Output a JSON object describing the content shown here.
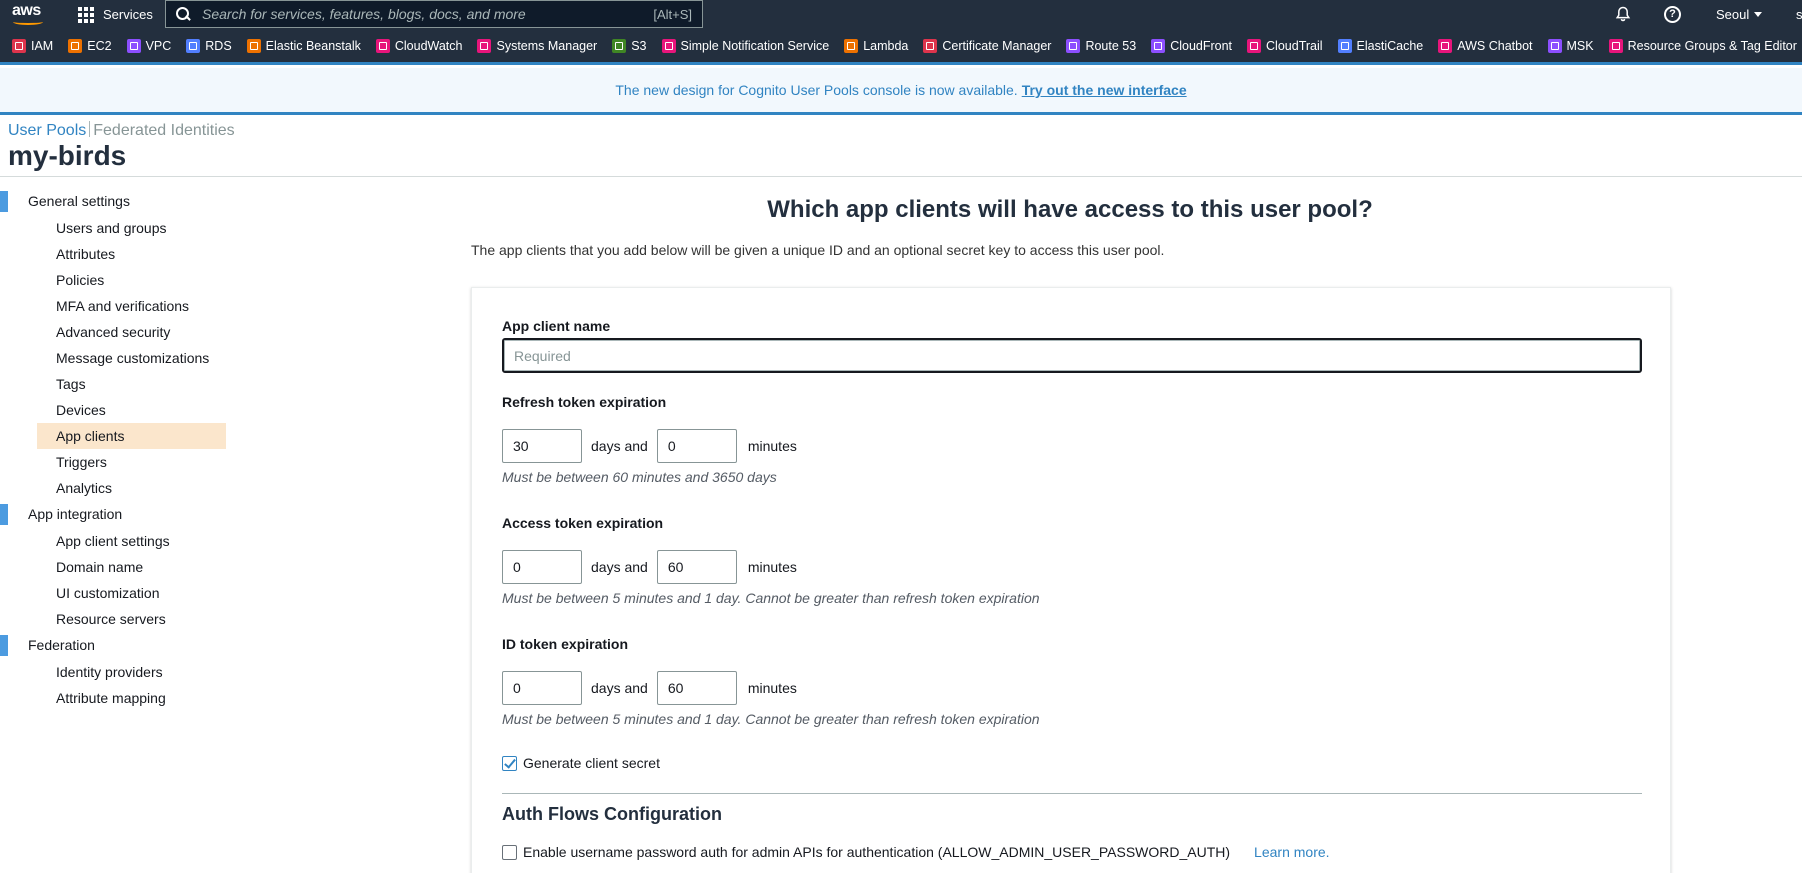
{
  "topnav": {
    "logo_text": "aws",
    "services_label": "Services",
    "search_placeholder": "Search for services, features, blogs, docs, and more",
    "search_shortcut": "[Alt+S]",
    "region": "Seoul",
    "account_initial": "s"
  },
  "favorites": [
    {
      "label": "IAM",
      "color": "#dd344c"
    },
    {
      "label": "EC2",
      "color": "#ed7100"
    },
    {
      "label": "VPC",
      "color": "#8c4fff"
    },
    {
      "label": "RDS",
      "color": "#527fff"
    },
    {
      "label": "Elastic Beanstalk",
      "color": "#ed7100"
    },
    {
      "label": "CloudWatch",
      "color": "#e7157b"
    },
    {
      "label": "Systems Manager",
      "color": "#e7157b"
    },
    {
      "label": "S3",
      "color": "#3f8624"
    },
    {
      "label": "Simple Notification Service",
      "color": "#e7157b"
    },
    {
      "label": "Lambda",
      "color": "#ed7100"
    },
    {
      "label": "Certificate Manager",
      "color": "#dd344c"
    },
    {
      "label": "Route 53",
      "color": "#8c4fff"
    },
    {
      "label": "CloudFront",
      "color": "#8c4fff"
    },
    {
      "label": "CloudTrail",
      "color": "#e7157b"
    },
    {
      "label": "ElastiCache",
      "color": "#527fff"
    },
    {
      "label": "AWS Chatbot",
      "color": "#e7157b"
    },
    {
      "label": "MSK",
      "color": "#8c4fff"
    },
    {
      "label": "Resource Groups & Tag Editor",
      "color": "#e7157b"
    }
  ],
  "banner": {
    "text": "The new design for Cognito User Pools console is now available.",
    "link": "Try out the new interface"
  },
  "breadcrumb": {
    "user_pools": "User Pools",
    "federated_identities": "Federated Identities"
  },
  "page_title": "my-birds",
  "sidebar": {
    "general_settings": "General settings",
    "general_items": [
      "Users and groups",
      "Attributes",
      "Policies",
      "MFA and verifications",
      "Advanced security",
      "Message customizations",
      "Tags",
      "Devices",
      "App clients",
      "Triggers",
      "Analytics"
    ],
    "app_integration": "App integration",
    "app_items": [
      "App client settings",
      "Domain name",
      "UI customization",
      "Resource servers"
    ],
    "federation": "Federation",
    "federation_items": [
      "Identity providers",
      "Attribute mapping"
    ],
    "active_item": "App clients"
  },
  "main": {
    "heading": "Which app clients will have access to this user pool?",
    "subtext": "The app clients that you add below will be given a unique ID and an optional secret key to access this user pool.",
    "app_client_name_label": "App client name",
    "app_client_name_placeholder": "Required",
    "refresh": {
      "label": "Refresh token expiration",
      "days": "30",
      "minutes": "0",
      "hint": "Must be between 60 minutes and 3650 days"
    },
    "access": {
      "label": "Access token expiration",
      "days": "0",
      "minutes": "60",
      "hint": "Must be between 5 minutes and 1 day. Cannot be greater than refresh token expiration"
    },
    "id_token": {
      "label": "ID token expiration",
      "days": "0",
      "minutes": "60",
      "hint": "Must be between 5 minutes and 1 day. Cannot be greater than refresh token expiration"
    },
    "days_and": "days and",
    "minutes": "minutes",
    "generate_secret_label": "Generate client secret",
    "auth_flows_heading": "Auth Flows Configuration",
    "admin_auth_label": "Enable username password auth for admin APIs for authentication (ALLOW_ADMIN_USER_PASSWORD_AUTH)",
    "learn_more": "Learn more."
  }
}
